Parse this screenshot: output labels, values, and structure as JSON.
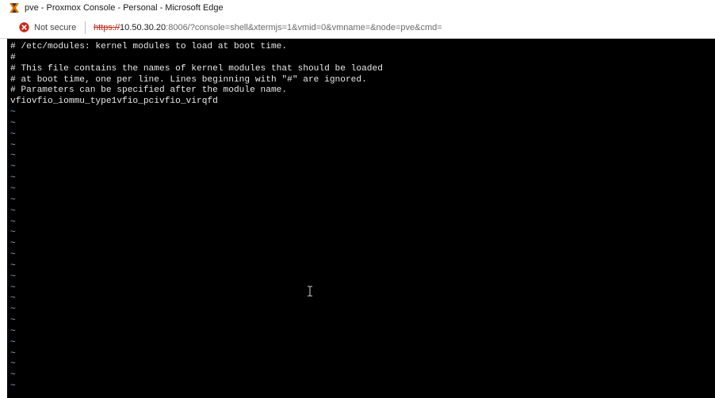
{
  "window": {
    "title": "pve - Proxmox Console - Personal - Microsoft Edge",
    "app_icon": "proxmox-logo-icon",
    "colors": {
      "proxmox_orange": "#e57000",
      "insecure_red": "#c42b1c"
    }
  },
  "address_bar": {
    "security_icon": "not-secure-icon",
    "security_label": "Not secure",
    "url_scheme": "https://",
    "url_host": "10.50.30.20",
    "url_rest": ":8006/?console=shell&xtermjs=1&vmid=0&vmname=&node=pve&cmd="
  },
  "terminal": {
    "background": "#000000",
    "file_lines": [
      "# /etc/modules: kernel modules to load at boot time.",
      "#",
      "# This file contains the names of kernel modules that should be loaded",
      "# at boot time, one per line. Lines beginning with \"#\" are ignored.",
      "# Parameters can be specified after the module name.",
      "vfiovfio_iommu_type1vfio_pcivfio_virqfd"
    ],
    "empty_line_marker": "~",
    "empty_line_count": 26,
    "pointer_icon": "text-cursor-icon"
  }
}
